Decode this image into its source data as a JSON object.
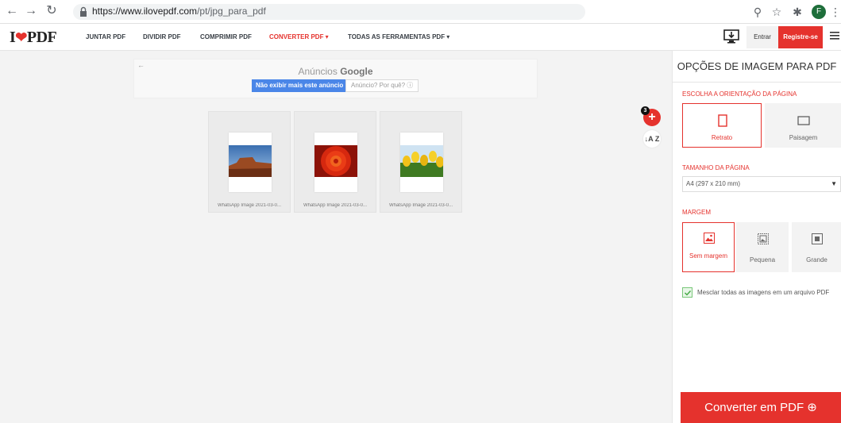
{
  "browser": {
    "url_host": "https://www.ilovepdf.com",
    "url_path": "/pt/jpg_para_pdf",
    "profile_initial": "F"
  },
  "header": {
    "logo_i": "I",
    "logo_pdf": "PDF",
    "nav": [
      {
        "label": "JUNTAR PDF"
      },
      {
        "label": "DIVIDIR PDF"
      },
      {
        "label": "COMPRIMIR PDF"
      },
      {
        "label": "CONVERTER PDF ▾"
      },
      {
        "label": "TODAS AS FERRAMENTAS PDF ▾"
      }
    ],
    "login_label": "Entrar",
    "register_label": "Registre-se"
  },
  "ad": {
    "title_prefix": "Anúncios",
    "title_brand": "Google",
    "hide_label": "Não exibir mais este anúncio",
    "why_label": "Anúncio? Por quê? ⓘ"
  },
  "files": [
    {
      "name": "WhatsApp Image 2021-03-0..."
    },
    {
      "name": "WhatsApp Image 2021-03-0..."
    },
    {
      "name": "WhatsApp Image 2021-03-0..."
    }
  ],
  "file_count_badge": "3",
  "sort_label": "↓A Z",
  "sidebar": {
    "title": "OPÇÕES DE IMAGEM PARA PDF",
    "orientation_label": "ESCOLHA A ORIENTAÇÃO DA PÁGINA",
    "orientation_options": [
      {
        "label": "Retrato",
        "selected": true
      },
      {
        "label": "Paisagem",
        "selected": false
      }
    ],
    "page_size_label": "TAMANHO DA PÁGINA",
    "page_size_value": "A4 (297 x 210 mm)",
    "margin_label": "MARGEM",
    "margin_options": [
      {
        "label": "Sem margem",
        "selected": true
      },
      {
        "label": "Pequena",
        "selected": false
      },
      {
        "label": "Grande",
        "selected": false
      }
    ],
    "merge_label": "Mesclar todas as imagens em um arquivo PDF",
    "convert_label": "Converter em PDF ⊕"
  },
  "colors": {
    "brand_red": "#e5322d",
    "ad_blue": "#4a86e8",
    "check_green": "#79c779"
  }
}
